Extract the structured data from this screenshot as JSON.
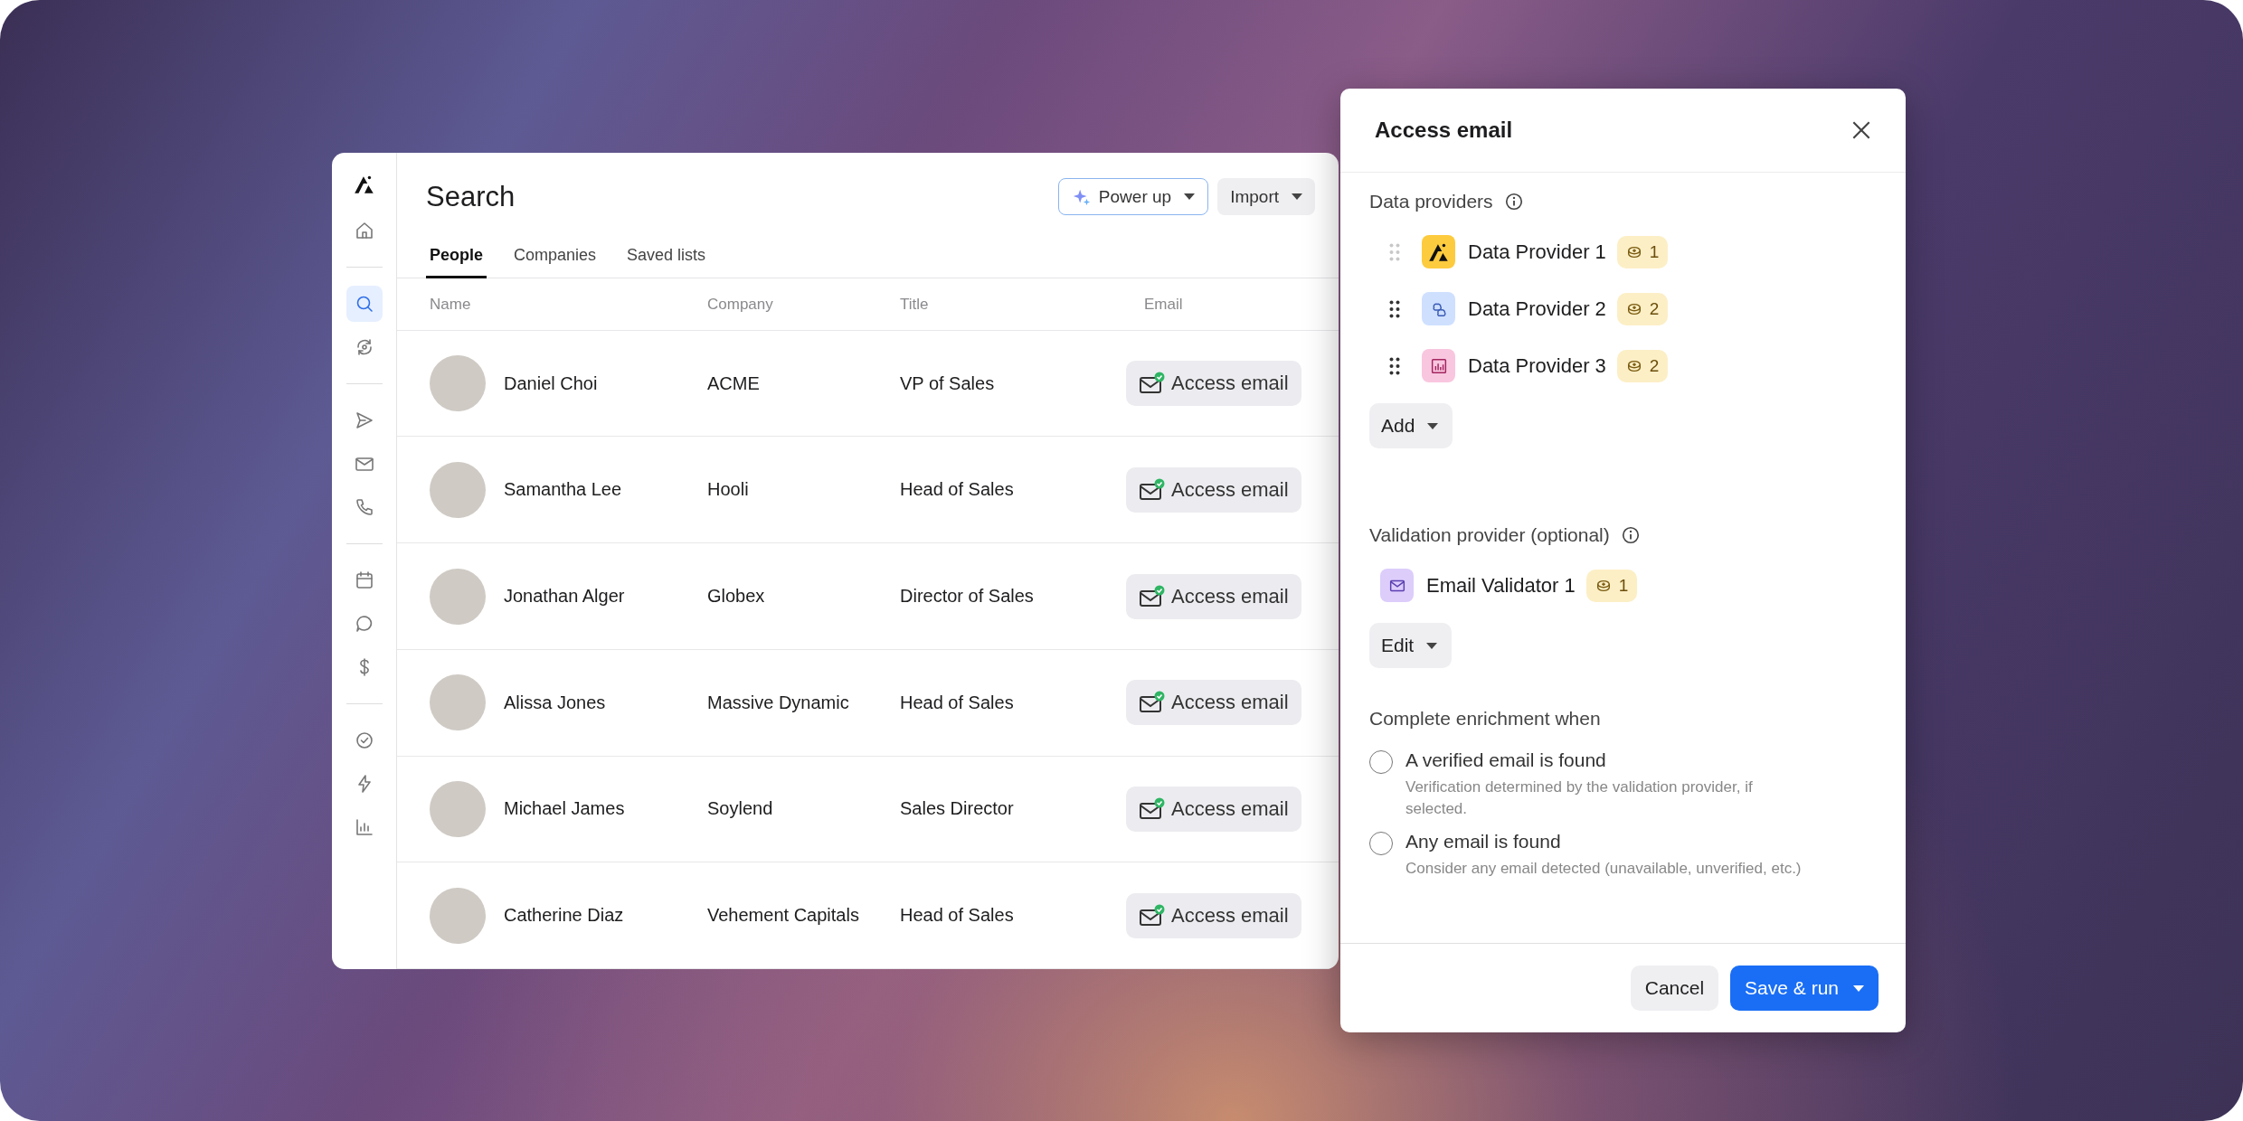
{
  "sidebar": {
    "groups": [
      {
        "items": [
          {
            "kind": "home",
            "selected": false
          }
        ]
      },
      {
        "items": [
          {
            "kind": "search",
            "selected": true
          },
          {
            "kind": "sync",
            "selected": false
          }
        ]
      },
      {
        "items": [
          {
            "kind": "send",
            "selected": false
          },
          {
            "kind": "mail",
            "selected": false
          },
          {
            "kind": "phone",
            "selected": false
          }
        ]
      },
      {
        "items": [
          {
            "kind": "calendar",
            "selected": false
          },
          {
            "kind": "chat",
            "selected": false
          },
          {
            "kind": "dollar",
            "selected": false
          }
        ]
      },
      {
        "items": [
          {
            "kind": "check",
            "selected": false
          },
          {
            "kind": "bolt",
            "selected": false
          },
          {
            "kind": "chart",
            "selected": false
          }
        ]
      }
    ]
  },
  "header": {
    "title": "Search",
    "buttons": [
      {
        "kind": "power",
        "label": "Power up"
      },
      {
        "kind": "plain",
        "label": "Import"
      }
    ]
  },
  "tabs": [
    {
      "label": "People",
      "selected": true
    },
    {
      "label": "Companies",
      "selected": false
    },
    {
      "label": "Saved lists",
      "selected": false
    }
  ],
  "table": {
    "columns": [
      "Name",
      "Company",
      "Title",
      "Email"
    ],
    "rows": [
      {
        "name": "Daniel Choi",
        "company": "ACME",
        "title": "VP of Sales",
        "email_action": "Access email"
      },
      {
        "name": "Samantha Lee",
        "company": "Hooli",
        "title": "Head of Sales",
        "email_action": "Access email"
      },
      {
        "name": "Jonathan Alger",
        "company": "Globex",
        "title": "Director of Sales",
        "email_action": "Access email"
      },
      {
        "name": "Alissa Jones",
        "company": "Massive Dynamic",
        "title": "Head of Sales",
        "email_action": "Access email"
      },
      {
        "name": "Michael James",
        "company": "Soylend",
        "title": "Sales Director",
        "email_action": "Access email"
      },
      {
        "name": "Catherine Diaz",
        "company": "Vehement Capitals",
        "title": "Head of Sales",
        "email_action": "Access email"
      }
    ]
  },
  "panel": {
    "title": "Access email",
    "data_providers": {
      "label": "Data providers",
      "providers": [
        {
          "name": "Data Provider 1",
          "kind": "logo",
          "color": "#fdcb3e",
          "cost": "1",
          "draggable": false
        },
        {
          "name": "Data Provider 2",
          "kind": "cloud",
          "color": "#cfe0ff",
          "cost": "2",
          "draggable": true
        },
        {
          "name": "Data Provider 3",
          "kind": "chart",
          "color": "#f9c6df",
          "cost": "2",
          "draggable": true
        }
      ],
      "button": "Add"
    },
    "validation": {
      "label": "Validation provider (optional)",
      "provider": {
        "name": "Email Validator 1",
        "kind": "mail",
        "color": "#dccdfb",
        "cost": "1"
      },
      "button": "Edit"
    },
    "completion": {
      "label": "Complete enrichment when",
      "options": [
        {
          "label": "A verified email is found",
          "description": "Verification determined by the validation provider, if selected.",
          "selected": false
        },
        {
          "label": "Any email is found",
          "description": "Consider any email detected (unavailable, unverified, etc.)",
          "selected": false
        }
      ]
    },
    "footer": {
      "cancel": "Cancel",
      "confirm": "Save & run"
    }
  }
}
